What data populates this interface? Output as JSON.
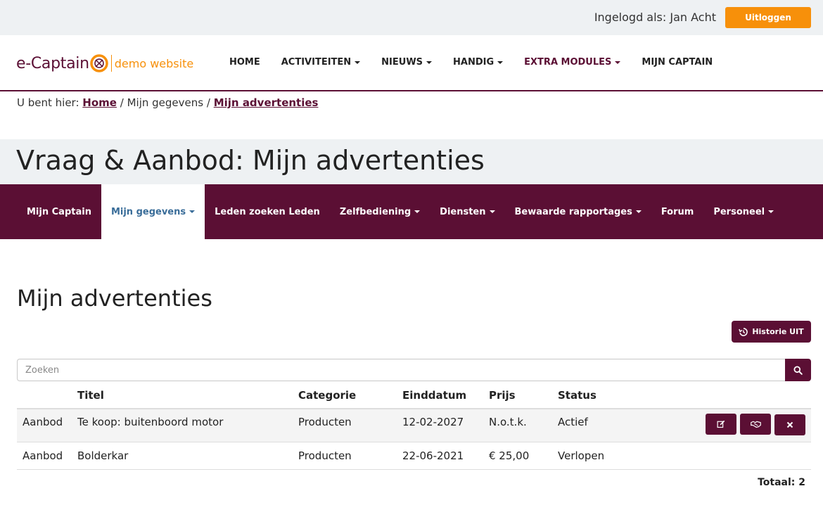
{
  "topbar": {
    "logged_in_text": "Ingelogd als: Jan Acht",
    "logout_label": "Uitloggen"
  },
  "logo": {
    "main": "e-Captain",
    "sub": "demo website"
  },
  "main_nav": [
    {
      "label": "HOME",
      "dropdown": false
    },
    {
      "label": "ACTIVITEITEN",
      "dropdown": true
    },
    {
      "label": "NIEUWS",
      "dropdown": true
    },
    {
      "label": "HANDIG",
      "dropdown": true
    },
    {
      "label": "EXTRA MODULES",
      "dropdown": true
    },
    {
      "label": "MIJN CAPTAIN",
      "dropdown": false
    }
  ],
  "breadcrumb": {
    "prefix": "U bent hier:",
    "home": "Home",
    "sep": "/",
    "middle": "Mijn gegevens",
    "current": "Mijn advertenties"
  },
  "page_title": "Vraag & Aanbod: Mijn advertenties",
  "sub_nav": [
    {
      "label": "Mijn Captain",
      "dropdown": false,
      "active": false
    },
    {
      "label": "Mijn gegevens",
      "dropdown": true,
      "active": true
    },
    {
      "label": "Leden zoeken Leden",
      "dropdown": false,
      "active": false
    },
    {
      "label": "Zelfbediening",
      "dropdown": true,
      "active": false
    },
    {
      "label": "Diensten",
      "dropdown": true,
      "active": false
    },
    {
      "label": "Bewaarde rapportages",
      "dropdown": true,
      "active": false
    },
    {
      "label": "Forum",
      "dropdown": false,
      "active": false
    },
    {
      "label": "Personeel",
      "dropdown": true,
      "active": false
    }
  ],
  "section_title": "Mijn advertenties",
  "historie_label": "Historie UIT",
  "search": {
    "placeholder": "Zoeken"
  },
  "table": {
    "headers": [
      "",
      "Titel",
      "Categorie",
      "Einddatum",
      "Prijs",
      "Status"
    ],
    "rows": [
      {
        "type": "Aanbod",
        "title": "Te koop: buitenboord motor",
        "category": "Producten",
        "end_date": "12-02-2027",
        "price": "N.o.t.k.",
        "status": "Actief"
      },
      {
        "type": "Aanbod",
        "title": "Bolderkar",
        "category": "Producten",
        "end_date": "22-06-2021",
        "price": "€ 25,00",
        "status": "Verlopen"
      }
    ]
  },
  "total": "Totaal: 2",
  "colors": {
    "brand": "#5b0f34",
    "accent": "#f7900a",
    "active_link": "#3a6d99"
  },
  "icons": {
    "history": "history-icon",
    "search": "search-icon",
    "edit": "edit-icon",
    "handshake": "handshake-icon",
    "delete": "close-icon"
  }
}
